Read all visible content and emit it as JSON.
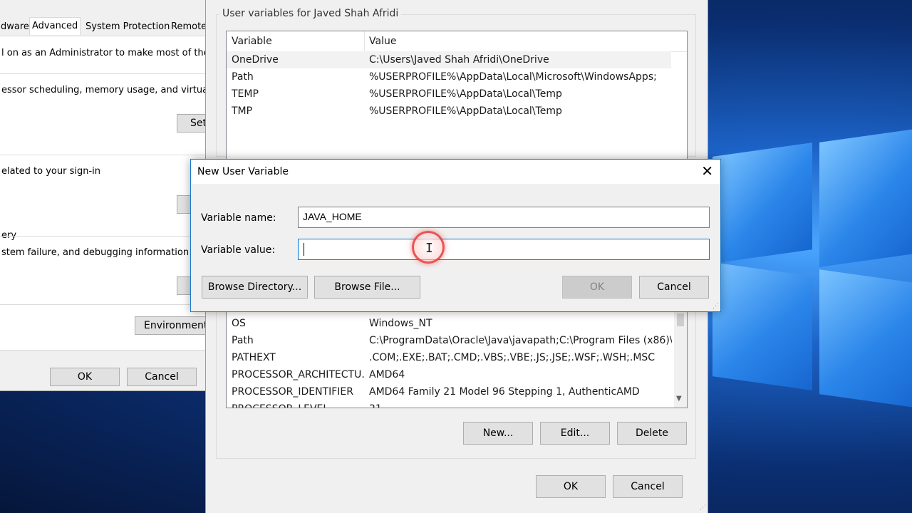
{
  "system_properties": {
    "tabs": [
      "dware",
      "Advanced",
      "System Protection",
      "Remote"
    ],
    "active_tab": "Advanced",
    "admin_note": "l on as an Administrator to make most of these cha",
    "performance_desc": "essor scheduling, memory usage, and virtual me",
    "settings_label": "Set",
    "profiles_desc": "elated to your sign-in",
    "startup_group": "ery",
    "startup_desc": "stem failure, and debugging information",
    "env_button_label": "Environment V",
    "ok_label": "OK",
    "cancel_label": "Cancel"
  },
  "env_dialog": {
    "user_vars_title": "User variables for Javed Shah Afridi",
    "columns": {
      "variable": "Variable",
      "value": "Value"
    },
    "user_vars": [
      {
        "name": "OneDrive",
        "value": "C:\\Users\\Javed Shah Afridi\\OneDrive"
      },
      {
        "name": "Path",
        "value": "%USERPROFILE%\\AppData\\Local\\Microsoft\\WindowsApps;"
      },
      {
        "name": "TEMP",
        "value": "%USERPROFILE%\\AppData\\Local\\Temp"
      },
      {
        "name": "TMP",
        "value": "%USERPROFILE%\\AppData\\Local\\Temp"
      }
    ],
    "system_vars": [
      {
        "name": "OS",
        "value": "Windows_NT"
      },
      {
        "name": "Path",
        "value": "C:\\ProgramData\\Oracle\\Java\\javapath;C:\\Program Files (x86)\\..."
      },
      {
        "name": "PATHEXT",
        "value": ".COM;.EXE;.BAT;.CMD;.VBS;.VBE;.JS;.JSE;.WSF;.WSH;.MSC"
      },
      {
        "name": "PROCESSOR_ARCHITECTU...",
        "value": "AMD64"
      },
      {
        "name": "PROCESSOR_IDENTIFIER",
        "value": "AMD64 Family 21 Model 96 Stepping 1, AuthenticAMD"
      },
      {
        "name": "PROCESSOR_LEVEL",
        "value": "21"
      }
    ],
    "buttons": {
      "new": "New...",
      "edit": "Edit...",
      "delete": "Delete",
      "ok": "OK",
      "cancel": "Cancel"
    }
  },
  "new_user_variable": {
    "title": "New User Variable",
    "name_label": "Variable name:",
    "name_value": "JAVA_HOME",
    "value_label": "Variable value:",
    "value_value": "",
    "browse_directory": "Browse Directory...",
    "browse_file": "Browse File...",
    "ok": "OK",
    "cancel": "Cancel"
  },
  "colors": {
    "accent": "#0078d7",
    "selection": "#f2f2f2",
    "cursor_ring": "#e83c3c"
  },
  "icons": {
    "close": "close-icon",
    "cursor": "ibeam-cursor-icon"
  }
}
